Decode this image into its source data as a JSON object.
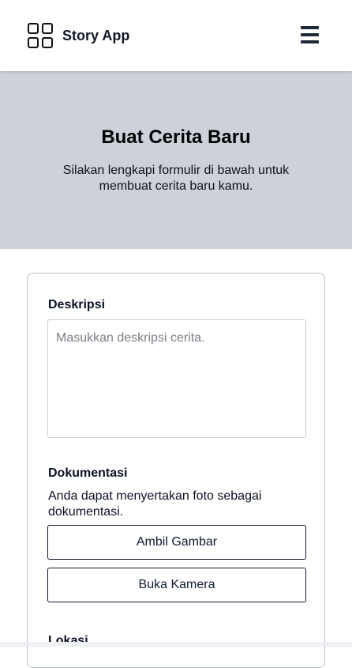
{
  "header": {
    "app_name": "Story App",
    "logo_icon": "grid-icon",
    "menu_icon": "hamburger-menu-icon"
  },
  "hero": {
    "title": "Buat Cerita Baru",
    "subtitle": "Silakan lengkapi formulir di bawah untuk membuat cerita baru kamu."
  },
  "form": {
    "description": {
      "label": "Deskripsi",
      "placeholder": "Masukkan deskripsi cerita.",
      "value": ""
    },
    "documentation": {
      "label": "Dokumentasi",
      "help_text": "Anda dapat menyertakan foto sebagai dokumentasi.",
      "take_picture_label": "Ambil Gambar",
      "open_camera_label": "Buka Kamera"
    },
    "location": {
      "label": "Lokasi"
    }
  },
  "colors": {
    "hero_background": "#cdd1da",
    "button_border": "#0f1a2e",
    "card_border": "#b9bcc2"
  }
}
